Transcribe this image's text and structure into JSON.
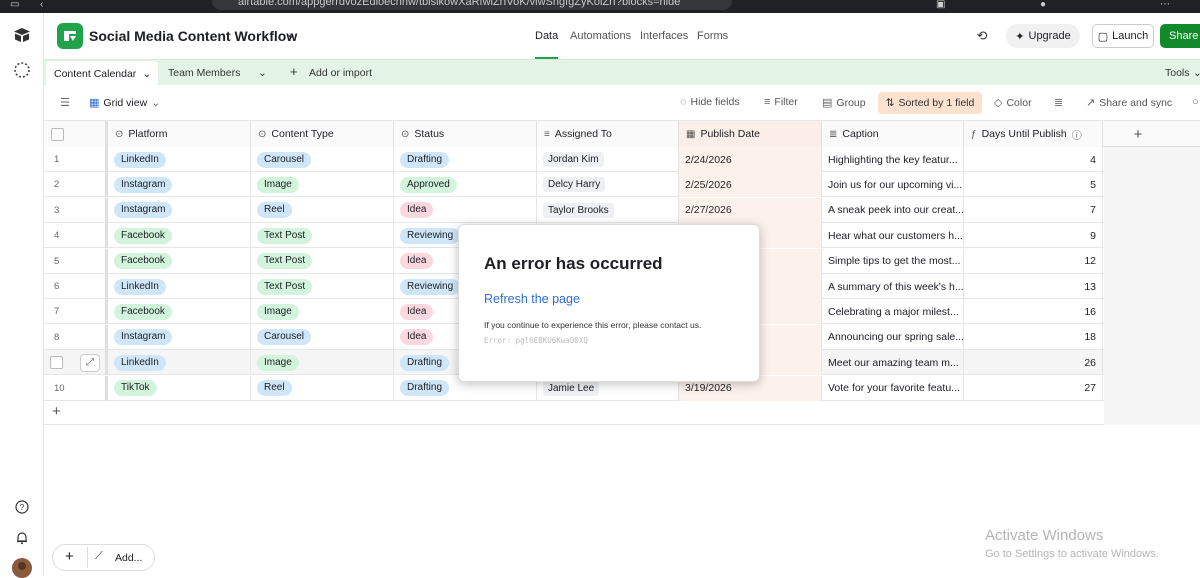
{
  "browser": {
    "url": "airtable.com/appgerrdvozEdioecnhw/tblsikowXaRfwiZrIVoK/viwSngfgZyKolZrI?blocks=hide"
  },
  "app": {
    "title": "Social Media Content Workflow",
    "nav": [
      "Data",
      "Automations",
      "Interfaces",
      "Forms"
    ],
    "active_nav": "Data",
    "upgrade_label": "Upgrade",
    "launch_label": "Launch",
    "share_label": "Share",
    "brand_color": "#20a34a"
  },
  "tabs": {
    "active": "Content Calendar",
    "other": "Team Members",
    "add_label": "Add or import",
    "tools_label": "Tools"
  },
  "toolbar": {
    "view_label": "Grid view",
    "hide_fields": "Hide fields",
    "filter": "Filter",
    "group": "Group",
    "sorted": "Sorted by 1 field",
    "color": "Color",
    "share_sync": "Share and sync"
  },
  "columns": [
    "Platform",
    "Content Type",
    "Status",
    "Assigned To",
    "Publish Date",
    "Caption",
    "Days Until Publish"
  ],
  "rows": [
    {
      "n": "1",
      "platform": "LinkedIn",
      "type": "Carousel",
      "status": "Drafting",
      "assigned": "Jordan Kim",
      "date": "2/24/2026",
      "caption": "Highlighting the key featur...",
      "days": "4"
    },
    {
      "n": "2",
      "platform": "Instagram",
      "type": "Image",
      "status": "Approved",
      "assigned": "Delcy Harry",
      "date": "2/25/2026",
      "caption": "Join us for our upcoming vi...",
      "days": "5"
    },
    {
      "n": "3",
      "platform": "Instagram",
      "type": "Reel",
      "status": "Idea",
      "assigned": "Taylor Brooks",
      "date": "2/27/2026",
      "caption": "A sneak peek into our creat...",
      "days": "7"
    },
    {
      "n": "4",
      "platform": "Facebook",
      "type": "Text Post",
      "status": "Reviewing",
      "assigned": "",
      "date": "",
      "caption": "Hear what our customers h...",
      "days": "9"
    },
    {
      "n": "5",
      "platform": "Facebook",
      "type": "Text Post",
      "status": "Idea",
      "assigned": "",
      "date": "",
      "caption": "Simple tips to get the most...",
      "days": "12"
    },
    {
      "n": "6",
      "platform": "LinkedIn",
      "type": "Text Post",
      "status": "Reviewing",
      "assigned": "",
      "date": "",
      "caption": "A summary of this week's h...",
      "days": "13"
    },
    {
      "n": "7",
      "platform": "Facebook",
      "type": "Image",
      "status": "Idea",
      "assigned": "",
      "date": "",
      "caption": "Celebrating a major milest...",
      "days": "16"
    },
    {
      "n": "8",
      "platform": "Instagram",
      "type": "Carousel",
      "status": "Idea",
      "assigned": "",
      "date": "",
      "caption": "Announcing our spring sale...",
      "days": "18"
    },
    {
      "n": "",
      "platform": "LinkedIn",
      "type": "Image",
      "status": "Drafting",
      "assigned": "",
      "date": "",
      "caption": "Meet our amazing team m...",
      "days": "26"
    },
    {
      "n": "10",
      "platform": "TikTok",
      "type": "Reel",
      "status": "Drafting",
      "assigned": "Jamie Lee",
      "date": "3/19/2026",
      "caption": "Vote for your favorite featu...",
      "days": "27"
    }
  ],
  "modal": {
    "title": "An error has occurred",
    "link": "Refresh the page",
    "message": "If you continue to experience this error, please contact us.",
    "error": "Error: pgl6E8KU6Kwa00XQ"
  },
  "bottom": {
    "add_label": "Add..."
  },
  "watermark": {
    "line1": "Activate Windows",
    "line2": "Go to Settings to activate Windows."
  },
  "colors": {
    "platform": {
      "LinkedIn": "#cfe6f9",
      "Instagram": "#cfe6f9",
      "Facebook": "#d2f3dc",
      "TikTok": "#d2f3dc"
    },
    "type": {
      "Carousel": "#cfe6f9",
      "Image": "#d2f3dc",
      "Reel": "#cfe6f9",
      "Text Post": "#d2f3dc"
    },
    "status": {
      "Drafting": "#cfe6f9",
      "Approved": "#d2f3dc",
      "Idea": "#fbd7e0",
      "Reviewing": "#cfe6f9"
    }
  }
}
